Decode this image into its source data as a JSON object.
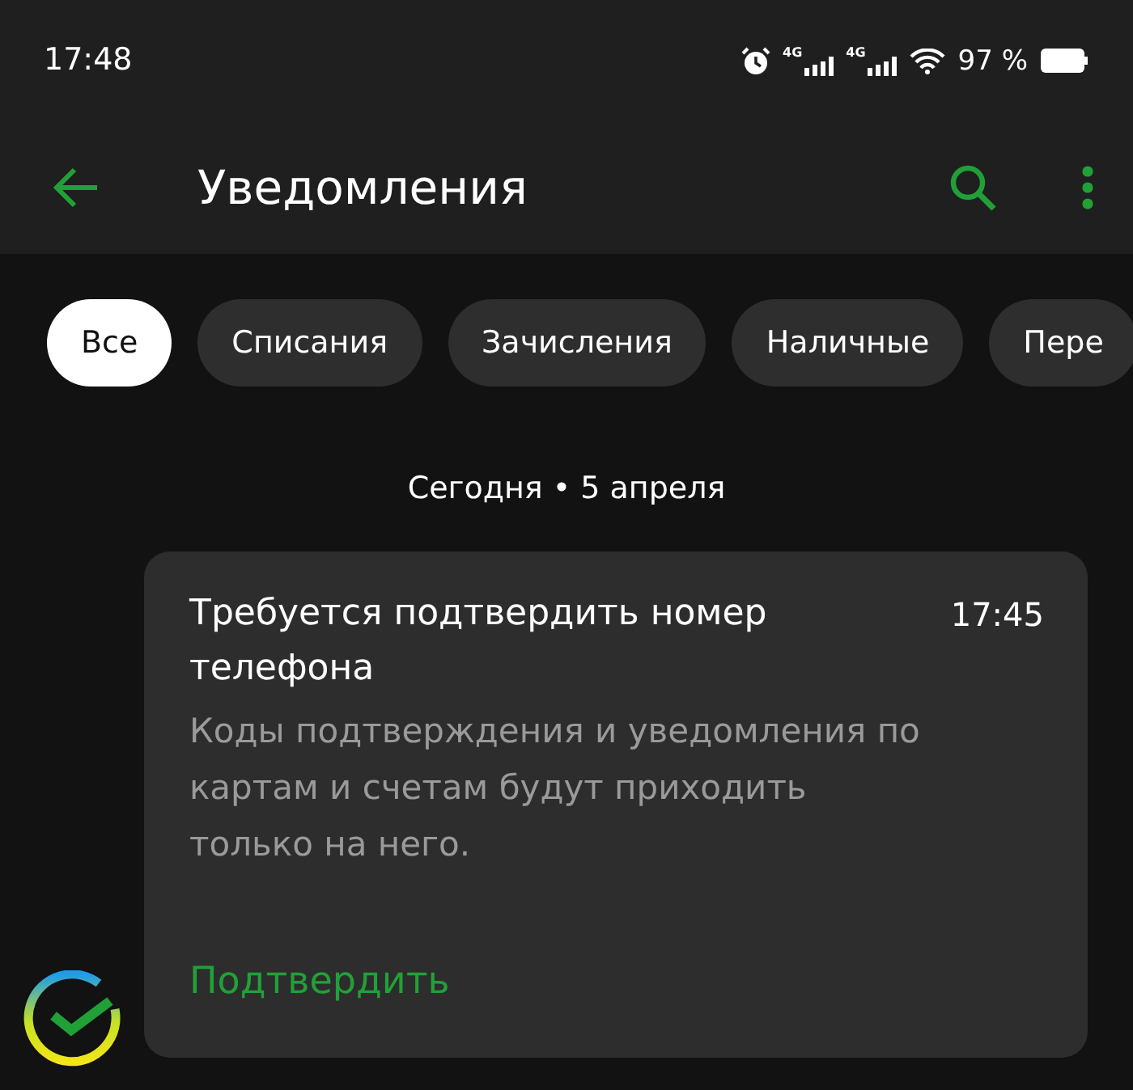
{
  "status_bar": {
    "time": "17:48",
    "networks": [
      "4G",
      "4G"
    ],
    "battery_text": "97 %"
  },
  "header": {
    "title": "Уведомления"
  },
  "filters": [
    {
      "label": "Все",
      "selected": true
    },
    {
      "label": "Списания",
      "selected": false
    },
    {
      "label": "Зачисления",
      "selected": false
    },
    {
      "label": "Наличные",
      "selected": false
    },
    {
      "label": "Пере",
      "selected": false
    }
  ],
  "date_header": "Сегодня • 5 апреля",
  "notifications": [
    {
      "title": "Требуется подтвердить номер телефона",
      "time": "17:45",
      "body": "Коды подтверждения и уведомления по картам и счетам будут приходить только на него.",
      "action": "Подтвердить"
    }
  ]
}
